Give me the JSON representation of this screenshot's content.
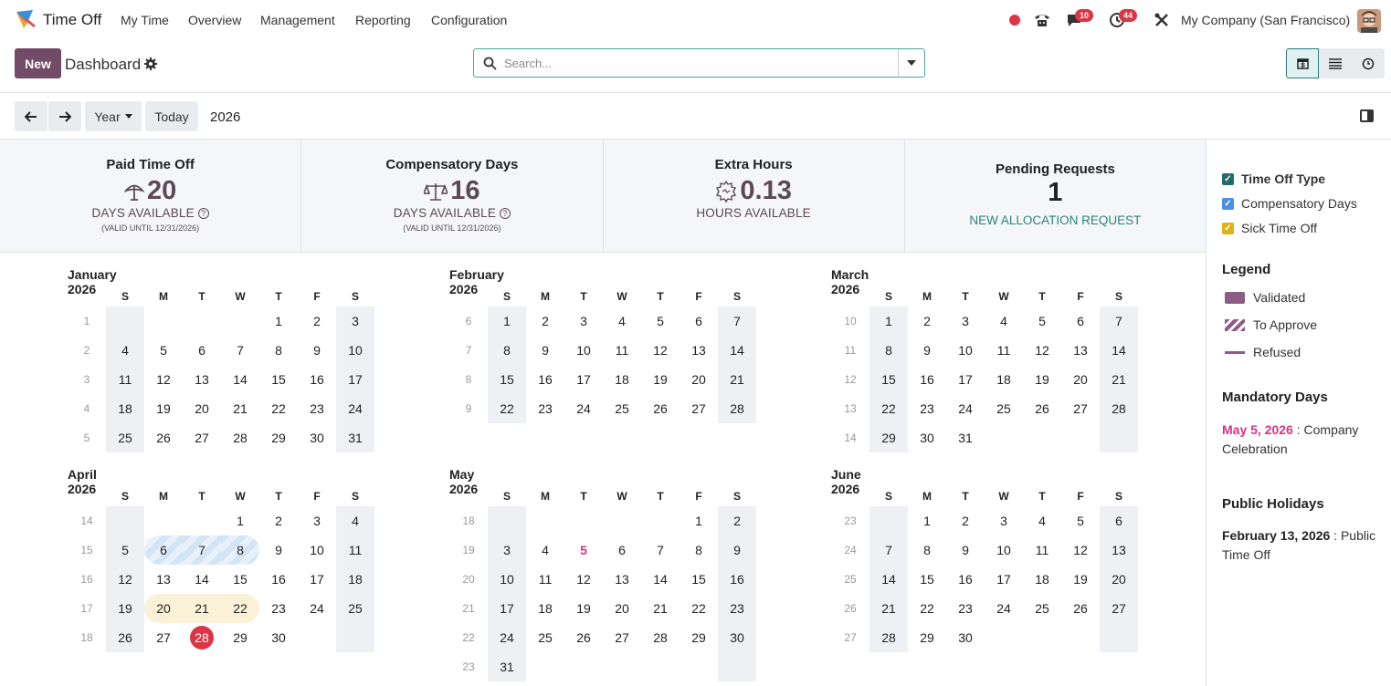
{
  "app": {
    "name": "Time Off"
  },
  "nav": {
    "items": [
      "My Time",
      "Overview",
      "Management",
      "Reporting",
      "Configuration"
    ]
  },
  "systray": {
    "messages_count": "10",
    "activities_count": "44",
    "company": "My Company (San Francisco)"
  },
  "control": {
    "new_label": "New",
    "title": "Dashboard",
    "search_placeholder": "Search..."
  },
  "navbar": {
    "scale_label": "Year",
    "today_label": "Today",
    "year": "2026"
  },
  "summary": [
    {
      "title": "Paid Time Off",
      "value": "20",
      "icon": "parasol-icon",
      "sub": "DAYS AVAILABLE",
      "valid": "(VALID UNTIL 12/31/2026)"
    },
    {
      "title": "Compensatory Days",
      "value": "16",
      "icon": "scales-icon",
      "sub": "DAYS AVAILABLE",
      "valid": "(VALID UNTIL 12/31/2026)"
    },
    {
      "title": "Extra Hours",
      "value": "0.13",
      "icon": "badge-icon",
      "sub": "HOURS AVAILABLE",
      "valid": ""
    },
    {
      "title": "Pending Requests",
      "value": "1",
      "icon": "",
      "sub": "",
      "link": "NEW ALLOCATION REQUEST"
    }
  ],
  "calendar": {
    "weekdays": [
      "S",
      "M",
      "T",
      "W",
      "T",
      "F",
      "S"
    ],
    "months": [
      {
        "name": "January 2026",
        "offset": 4,
        "days": 31,
        "week_start": 1,
        "highlight": {}
      },
      {
        "name": "February 2026",
        "offset": 0,
        "days": 28,
        "week_start": 6,
        "highlight": {}
      },
      {
        "name": "March 2026",
        "offset": 0,
        "days": 31,
        "week_start": 10,
        "highlight": {}
      },
      {
        "name": "April 2026",
        "offset": 3,
        "days": 30,
        "week_start": 14,
        "highlight": {
          "hatch": [
            6,
            7,
            8
          ],
          "cream": [
            20,
            21,
            22
          ],
          "today": 28
        }
      },
      {
        "name": "May 2026",
        "offset": 5,
        "days": 31,
        "week_start": 18,
        "highlight": {
          "mandatory": [
            5
          ]
        }
      },
      {
        "name": "June 2026",
        "offset": 1,
        "days": 30,
        "week_start": 23,
        "highlight": {}
      }
    ]
  },
  "sidepanel": {
    "filter_title": "Time Off Type",
    "filters": [
      {
        "label": "Compensatory Days",
        "color": "#4a90e2"
      },
      {
        "label": "Sick Time Off",
        "color": "#e0b21a"
      }
    ],
    "legend_title": "Legend",
    "legend": [
      "Validated",
      "To Approve",
      "Refused"
    ],
    "mandatory_title": "Mandatory Days",
    "mandatory_date": "May 5, 2026",
    "mandatory_text": " : Company Celebration",
    "holidays_title": "Public Holidays",
    "holiday_date": "February 13, 2026",
    "holiday_text": " : Public Time Off"
  }
}
